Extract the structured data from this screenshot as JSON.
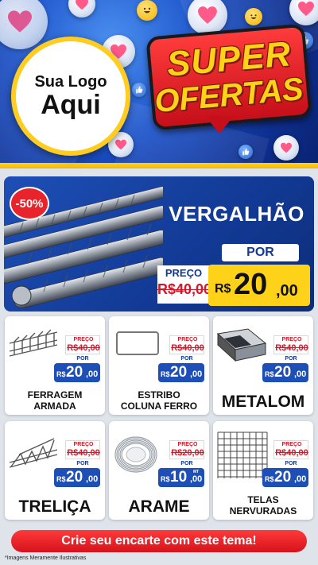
{
  "logo": {
    "line1": "Sua Logo",
    "line2": "Aqui"
  },
  "badge": {
    "line1": "SUPER",
    "line2": "OFERTAS"
  },
  "featured": {
    "discount": "-50%",
    "name": "VERGALHÃO",
    "preco_label": "PREÇO",
    "old_price": "R$40,00",
    "por_label": "POR",
    "currency": "R$",
    "price_int": "20",
    "price_dec": ",00"
  },
  "products": [
    {
      "name": "FERRAGEM ARMADA",
      "preco_label": "PREÇO",
      "old_price": "R$40,00",
      "por_label": "POR",
      "currency": "R$",
      "price_int": "20",
      "price_dec": ",00",
      "unit": ""
    },
    {
      "name": "ESTRIBO COLUNA FERRO",
      "preco_label": "PREÇO",
      "old_price": "R$40,00",
      "por_label": "POR",
      "currency": "R$",
      "price_int": "20",
      "price_dec": ",00",
      "unit": ""
    },
    {
      "name": "METALOM",
      "preco_label": "PREÇO",
      "old_price": "R$40,00",
      "por_label": "POR",
      "currency": "R$",
      "price_int": "20",
      "price_dec": ",00",
      "unit": ""
    },
    {
      "name": "TRELIÇA",
      "preco_label": "PREÇO",
      "old_price": "R$40,00",
      "por_label": "POR",
      "currency": "R$",
      "price_int": "20",
      "price_dec": ",00",
      "unit": ""
    },
    {
      "name": "ARAME",
      "preco_label": "PREÇO",
      "old_price": "R$20,00",
      "por_label": "POR",
      "currency": "R$",
      "price_int": "10",
      "price_dec": ",00",
      "unit": "MT"
    },
    {
      "name": "TELAS NERVURADAS",
      "preco_label": "PREÇO",
      "old_price": "R$40,00",
      "por_label": "POR",
      "currency": "R$",
      "price_int": "20",
      "price_dec": ",00",
      "unit": ""
    }
  ],
  "cta": "Crie seu encarte com este tema!",
  "disclaimer": "*Imagens Meramente Ilustrativas",
  "colors": {
    "blue": "#1e4fb6",
    "red": "#d5121c",
    "yellow": "#ffd21a"
  },
  "icons": [
    "heart-icon",
    "like-icon",
    "laugh-icon"
  ]
}
